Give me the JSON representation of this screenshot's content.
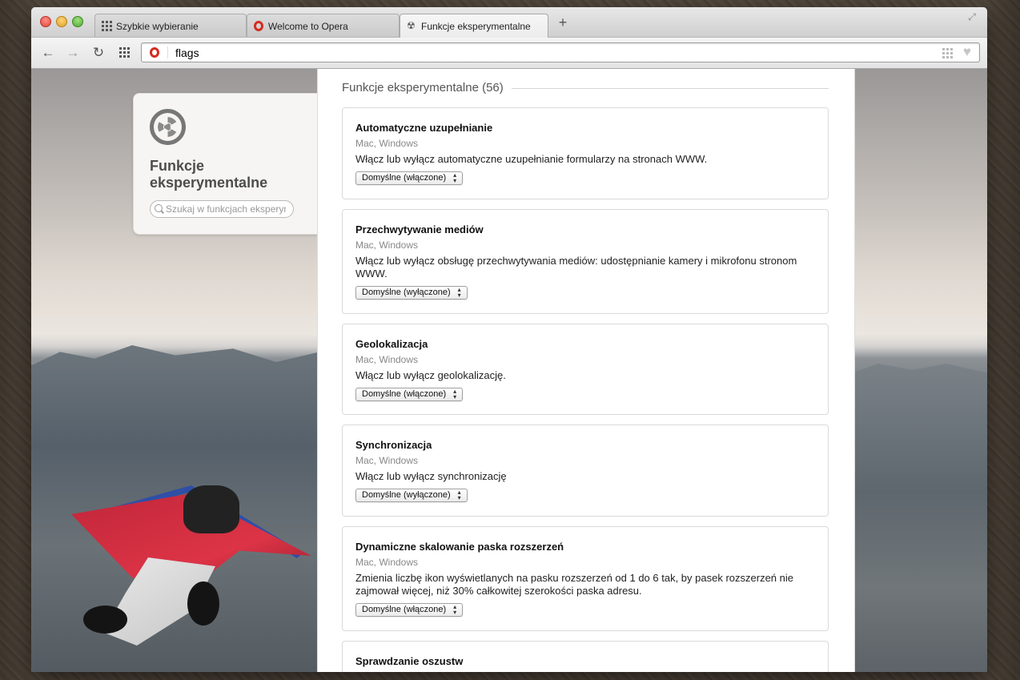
{
  "tabs": [
    {
      "label": "Szybkie wybieranie",
      "icon": "grid-icon"
    },
    {
      "label": "Welcome to Opera",
      "icon": "opera-icon"
    },
    {
      "label": "Funkcje eksperymentalne",
      "icon": "radiation-icon",
      "active": true
    }
  ],
  "new_tab_label": "+",
  "toolbar": {
    "back": "←",
    "forward": "→",
    "reload": "↻",
    "address_value": "flags"
  },
  "sidebar": {
    "title": "Funkcje eksperymentalne",
    "search_placeholder": "Szukaj w funkcjach eksperymentalnych"
  },
  "main": {
    "heading": "Funkcje eksperymentalne (56)",
    "flags": [
      {
        "title": "Automatyczne uzupełnianie",
        "platforms": "Mac, Windows",
        "description": "Włącz lub wyłącz automatyczne uzupełnianie formularzy na stronach WWW.",
        "value": "Domyślne (włączone)"
      },
      {
        "title": "Przechwytywanie mediów",
        "platforms": "Mac, Windows",
        "description": "Włącz lub wyłącz obsługę przechwytywania mediów: udostępnianie kamery i mikrofonu stronom WWW.",
        "value": "Domyślne (wyłączone)"
      },
      {
        "title": "Geolokalizacja",
        "platforms": "Mac, Windows",
        "description": "Włącz lub wyłącz geolokalizację.",
        "value": "Domyślne (włączone)"
      },
      {
        "title": "Synchronizacja",
        "platforms": "Mac, Windows",
        "description": "Włącz lub wyłącz synchronizację",
        "value": "Domyślne (wyłączone)"
      },
      {
        "title": "Dynamiczne skalowanie paska rozszerzeń",
        "platforms": "Mac, Windows",
        "description": "Zmienia liczbę ikon wyświetlanych na pasku rozszerzeń od 1 do 6 tak, by pasek rozszerzeń nie zajmował więcej, niż 30% całkowitej szerokości paska adresu.",
        "value": "Domyślne (włączone)"
      },
      {
        "title": "Sprawdzanie oszustw"
      }
    ]
  }
}
